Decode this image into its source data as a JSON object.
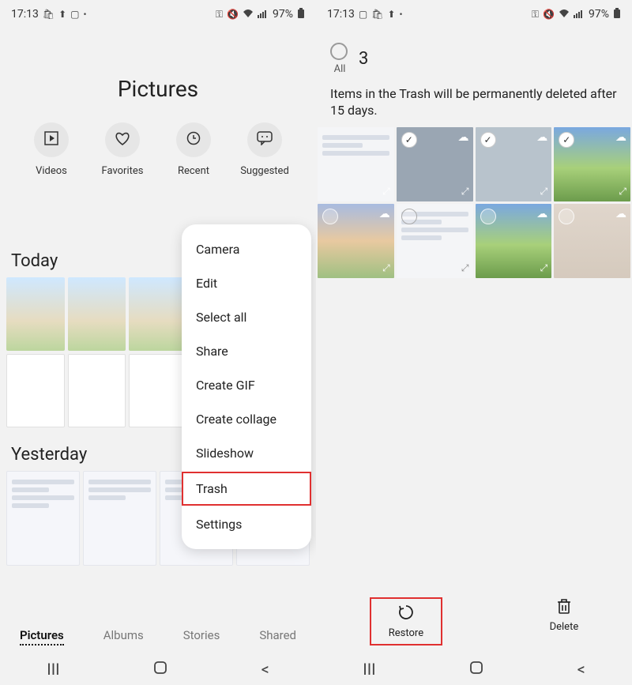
{
  "statusbar": {
    "time": "17:13",
    "battery": "97%"
  },
  "left": {
    "title": "Pictures",
    "quick": [
      {
        "label": "Videos"
      },
      {
        "label": "Favorites"
      },
      {
        "label": "Recent"
      },
      {
        "label": "Suggested"
      }
    ],
    "section_today": "Today",
    "section_yesterday": "Yesterday",
    "tabs": [
      {
        "label": "Pictures",
        "selected": true
      },
      {
        "label": "Albums"
      },
      {
        "label": "Stories"
      },
      {
        "label": "Shared"
      }
    ],
    "menu": [
      "Camera",
      "Edit",
      "Select all",
      "Share",
      "Create GIF",
      "Create collage",
      "Slideshow",
      "Trash",
      "Settings"
    ]
  },
  "right": {
    "all_label": "All",
    "selected_count": "3",
    "trash_msg": "Items in the Trash will be permanently deleted after 15 days.",
    "actions": {
      "restore": "Restore",
      "delete": "Delete"
    }
  }
}
